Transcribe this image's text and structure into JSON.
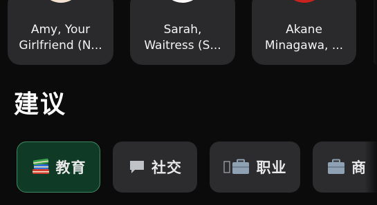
{
  "characters": [
    {
      "name": "Amy, Your\nGirlfriend (N...",
      "avatar_icon": "avatar-amy"
    },
    {
      "name": "Sarah,\nWaitress (S...",
      "avatar_icon": "avatar-sarah"
    },
    {
      "name": "Akane\nMinagawa, ...",
      "avatar_icon": "avatar-akane"
    }
  ],
  "suggestions": {
    "title": "建议",
    "categories": [
      {
        "label": "教育",
        "icon": "books-icon",
        "selected": true
      },
      {
        "label": "社交",
        "icon": "speech-bubble-icon",
        "selected": false
      },
      {
        "label": "职业",
        "icon": "briefcase-icon",
        "selected": false
      },
      {
        "label": "商",
        "icon": "briefcase-icon",
        "selected": false
      }
    ]
  },
  "colors": {
    "background": "#0b0b0c",
    "card": "#2a2a2c",
    "chip": "#2c2c2e",
    "chip_selected_bg": "#0f3a26",
    "chip_selected_border": "#3f8a63"
  }
}
